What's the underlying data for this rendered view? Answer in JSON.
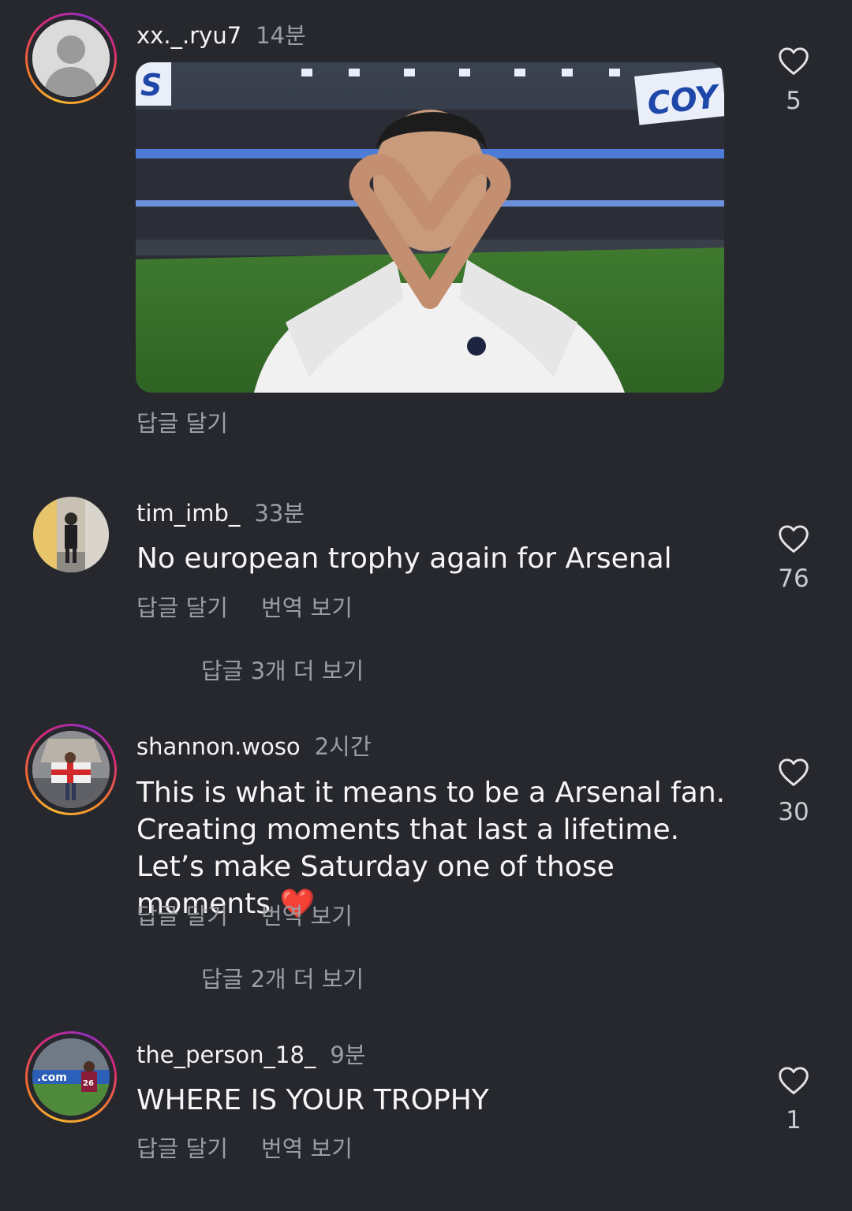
{
  "comments": [
    {
      "username": "xx._.ryu7",
      "time": "14분",
      "has_story_ring": true,
      "avatar": "default-avatar",
      "media": "gif-player-heart-hands",
      "actions": [
        "답글 달기"
      ],
      "likes": "5"
    },
    {
      "username": "tim_imb_",
      "time": "33분",
      "has_story_ring": false,
      "avatar": "photo-person-hallway",
      "text": "No european trophy again for Arsenal",
      "actions": [
        "답글 달기",
        "번역 보기"
      ],
      "more_replies": "답글 3개 더 보기",
      "likes": "76"
    },
    {
      "username": "shannon.woso",
      "time": "2시간",
      "has_story_ring": true,
      "avatar": "photo-person-flag-stadium",
      "text": "This is what it means to be a Arsenal fan. Creating moments that last a lifetime. Let’s make Saturday one of those moments",
      "emoji": "❤️",
      "actions": [
        "답글 달기",
        "번역 보기"
      ],
      "more_replies": "답글 2개 더 보기",
      "likes": "30"
    },
    {
      "username": "the_person_18_",
      "time": "9분",
      "has_story_ring": true,
      "avatar": "photo-footballer-26",
      "text": "WHERE IS YOUR TROPHY",
      "actions": [
        "답글 달기",
        "번역 보기"
      ],
      "likes": "1"
    }
  ],
  "colors": {
    "background": "#26282e",
    "secondary_text": "#9c9ea4",
    "primary_text": "#f6f6f6"
  }
}
